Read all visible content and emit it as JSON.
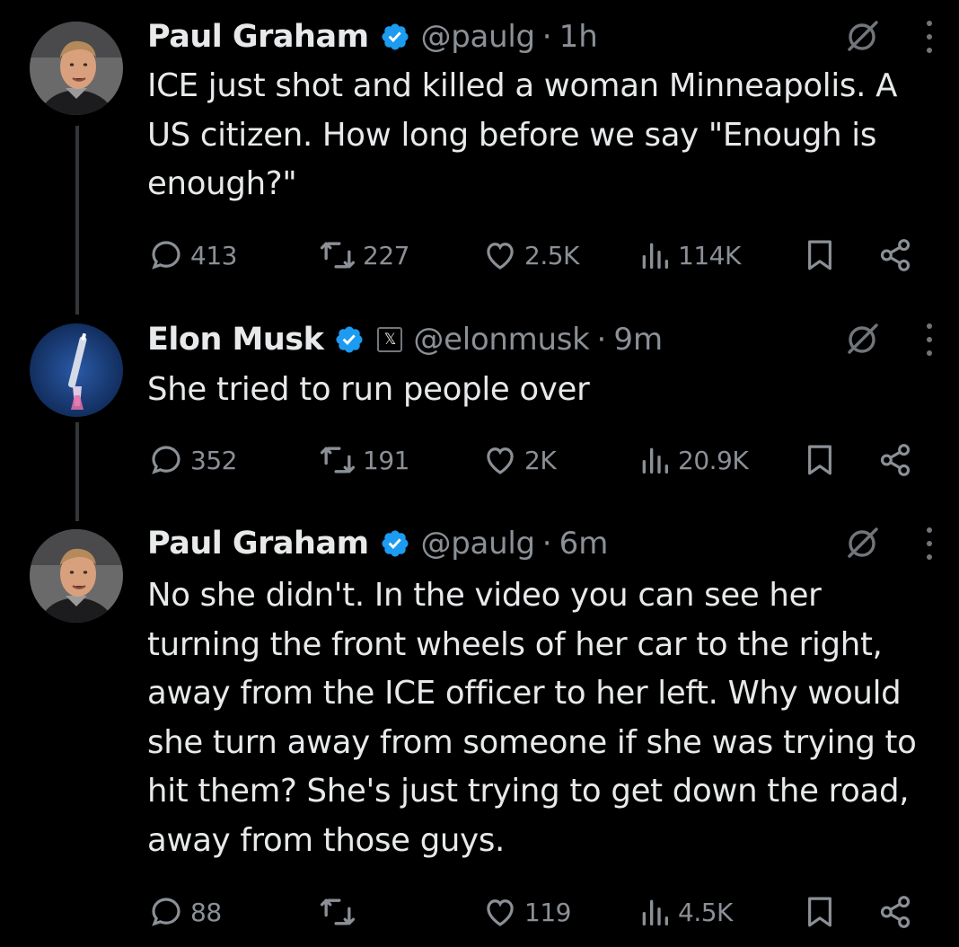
{
  "thread": [
    {
      "author": "Paul Graham",
      "handle": "@paulg",
      "separator": "·",
      "time": "1h",
      "text": "ICE just shot and killed a woman Minneapolis. A US citizen. How long before we say \"Enough is enough?\"",
      "replies": "413",
      "reposts": "227",
      "likes": "2.5K",
      "views": "114K",
      "verified": true,
      "affiliate_badge": null,
      "avatar_icon": "paul-graham-avatar"
    },
    {
      "author": "Elon Musk",
      "handle": "@elonmusk",
      "separator": "·",
      "time": "9m",
      "text": "She tried to run people over",
      "replies": "352",
      "reposts": "191",
      "likes": "2K",
      "views": "20.9K",
      "verified": true,
      "affiliate_badge": "𝕏",
      "avatar_icon": "rocket-launch-avatar"
    },
    {
      "author": "Paul Graham",
      "handle": "@paulg",
      "separator": "·",
      "time": "6m",
      "text": "No she didn't. In the video you can see her turning the front wheels of her car to the right, away from the ICE officer to her left. Why would she turn away from someone if she was trying to hit them? She's just trying to get down the road, away from those guys.",
      "replies": "88",
      "reposts": "",
      "likes": "119",
      "views": "4.5K",
      "verified": true,
      "affiliate_badge": null,
      "avatar_icon": "paul-graham-avatar"
    }
  ],
  "colors": {
    "background": "#000000",
    "text_primary": "#e7e9ea",
    "text_secondary": "#71767b",
    "verified_blue": "#1d9bf0",
    "thread_line": "#333639"
  },
  "icons": {
    "reply": "reply-icon",
    "repost": "repost-icon",
    "like": "heart-icon",
    "views": "views-icon",
    "bookmark": "bookmark-icon",
    "share": "share-icon",
    "grok": "grok-icon",
    "more": "more-icon",
    "verified": "verified-badge-icon"
  }
}
